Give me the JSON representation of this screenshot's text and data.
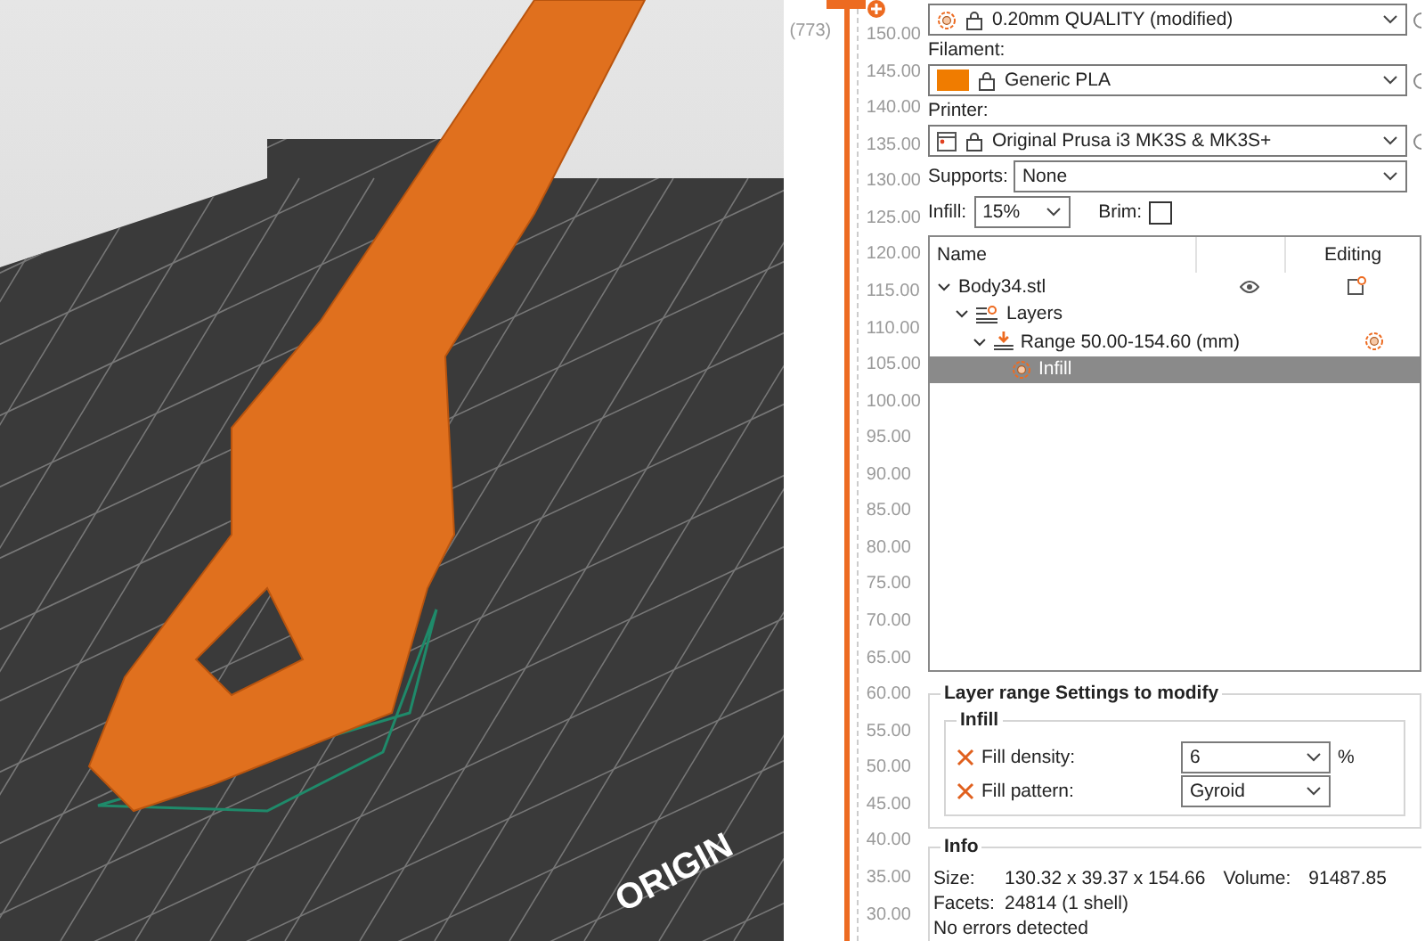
{
  "viewport": {
    "bed_label": "ORIGIN"
  },
  "layer_slider": {
    "layer_count": "(773)",
    "ticks": [
      "150.00",
      "145.00",
      "140.00",
      "135.00",
      "130.00",
      "125.00",
      "120.00",
      "115.00",
      "110.00",
      "105.00",
      "100.00",
      "95.00",
      "90.00",
      "85.00",
      "80.00",
      "75.00",
      "70.00",
      "65.00",
      "60.00",
      "55.00",
      "50.00",
      "45.00",
      "40.00",
      "35.00",
      "30.00"
    ]
  },
  "presets": [
    {
      "kind": "print",
      "value": "0.20mm QUALITY (modified)"
    },
    {
      "kind": "filament",
      "label": "Filament:",
      "value": "Generic PLA",
      "color": "#f07c00"
    },
    {
      "kind": "printer",
      "label": "Printer:",
      "value": "Original Prusa i3 MK3S & MK3S+"
    }
  ],
  "supports": {
    "label": "Supports:",
    "value": "None"
  },
  "infill": {
    "label": "Infill:",
    "value": "15%"
  },
  "brim": {
    "label": "Brim:",
    "checked": false
  },
  "object_list": {
    "columns": [
      "Name",
      "Editing"
    ],
    "items": [
      {
        "kind": "object",
        "name": "Body34.stl",
        "expanded": true,
        "selected": false,
        "children": [
          {
            "kind": "layers",
            "name": "Layers",
            "expanded": true,
            "selected": false,
            "children": [
              {
                "kind": "range",
                "name": "Range 50.00-154.60 (mm)",
                "expanded": true,
                "selected": false,
                "children": [
                  {
                    "kind": "setting",
                    "name": "Infill",
                    "selected": true
                  }
                ]
              }
            ]
          }
        ]
      }
    ]
  },
  "layer_settings": {
    "title": "Layer range Settings to modify",
    "group": "Infill",
    "rows": [
      {
        "label": "Fill density:",
        "value": "6",
        "unit": "%"
      },
      {
        "label": "Fill pattern:",
        "value": "Gyroid"
      }
    ]
  },
  "info": {
    "title": "Info",
    "size_label": "Size:",
    "size": "130.32 x 39.37 x 154.66",
    "volume_label": "Volume:",
    "volume": "91487.85",
    "facets_label": "Facets:",
    "facets": "24814 (1 shell)",
    "status": "No errors detected"
  }
}
